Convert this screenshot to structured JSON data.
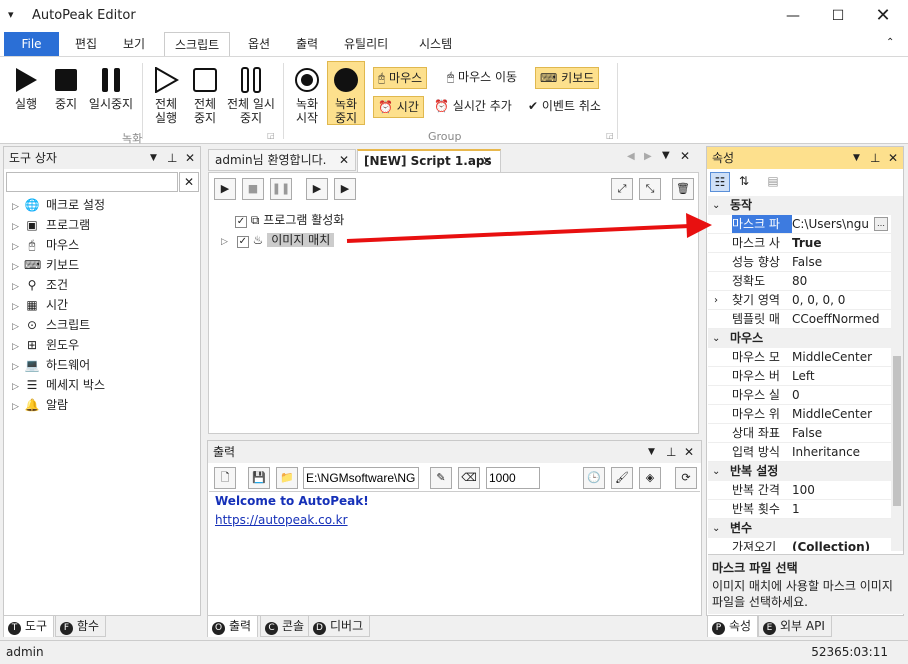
{
  "app": {
    "title": "AutoPeak Editor"
  },
  "menu_tabs": [
    "File",
    "편집",
    "보기",
    "스크립트",
    "옵션",
    "출력",
    "유틸리티",
    "시스템"
  ],
  "ribbon": {
    "run": "실행",
    "stop": "중지",
    "pause": "일시중지",
    "run_all": "전체 실행",
    "stop_all": "전체 중지",
    "pause_all": "전체 일시중지",
    "group1_label": "녹화",
    "rec_start": "녹화 시작",
    "rec_stop": "녹화 중지",
    "mouse": "마우스",
    "mouse_move": "마우스 이동",
    "keyboard": "키보드",
    "time": "시간",
    "realtime_add": "실시간 추가",
    "event_cancel": "이벤트 취소",
    "group2_label": "Group"
  },
  "toolbox": {
    "title": "도구 상자",
    "search_placeholder": "",
    "items": [
      "매크로 설정",
      "프로그램",
      "마우스",
      "키보드",
      "조건",
      "시간",
      "스크립트",
      "윈도우",
      "하드웨어",
      "메세지 박스",
      "알람"
    ],
    "bottom_tabs": [
      "도구",
      "함수"
    ]
  },
  "doc_tabs": {
    "welcome": "admin님 환영합니다.",
    "script": "[NEW] Script 1.aps"
  },
  "script_tree": {
    "item1": "프로그램 활성화",
    "item2": "이미지 매치"
  },
  "output": {
    "title": "출력",
    "path": "E:\\NGMsoftware\\NG",
    "number": "1000",
    "welcome": "Welcome to AutoPeak!",
    "link": "https://autopeak.co.kr",
    "bottom_tabs": [
      "출력",
      "콘솔",
      "디버그"
    ]
  },
  "properties": {
    "title": "속성",
    "rows": [
      {
        "type": "cat",
        "name": "동작"
      },
      {
        "name": "마스크 파",
        "value": "C:\\Users\\ngu",
        "selected": true
      },
      {
        "name": "마스크 사",
        "value": "True",
        "bold": true
      },
      {
        "name": "성능 향상",
        "value": "False"
      },
      {
        "name": "정확도",
        "value": "80"
      },
      {
        "name": "찾기 영역",
        "value": "0, 0, 0, 0",
        "expand": true
      },
      {
        "name": "템플릿 매",
        "value": "CCoeffNormed"
      },
      {
        "type": "cat",
        "name": "마우스"
      },
      {
        "name": "마우스 모",
        "value": "MiddleCenter"
      },
      {
        "name": "마우스 버",
        "value": "Left"
      },
      {
        "name": "마우스 실",
        "value": "0"
      },
      {
        "name": "마우스 위",
        "value": "MiddleCenter"
      },
      {
        "name": "상대 좌표",
        "value": "False"
      },
      {
        "name": "입력 방식",
        "value": "Inheritance"
      },
      {
        "type": "cat",
        "name": "반복 설정"
      },
      {
        "name": "반복 간격",
        "value": "100"
      },
      {
        "name": "반복 횟수",
        "value": "1"
      },
      {
        "type": "cat",
        "name": "변수"
      },
      {
        "name": "가져오기",
        "value": "(Collection)",
        "bold": true
      }
    ],
    "desc_title": "마스크 파일 선택",
    "desc_text": "이미지 매치에 사용할 마스크 이미지 파일을 선택하세요.",
    "bottom_tabs": [
      "속성",
      "외부 API"
    ]
  },
  "status": {
    "left": "admin",
    "right": "52365:03:11"
  }
}
